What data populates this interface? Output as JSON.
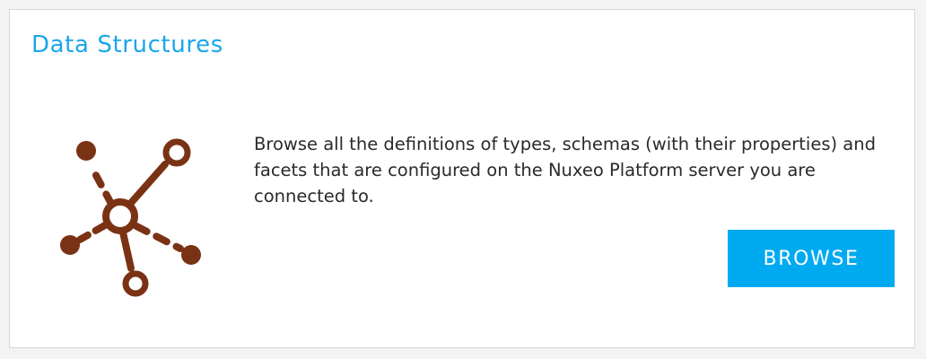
{
  "card": {
    "title": "Data Structures",
    "description": "Browse all the definitions of types, schemas (with their properties) and facets that are configured on the Nuxeo Platform server you are connected to.",
    "browse_label": "BROWSE",
    "icon": "network-graph-icon"
  },
  "colors": {
    "title": "#1ba6ea",
    "icon": "#7a3214",
    "button_background": "#00aaf0",
    "button_text": "#ffffff",
    "body_text": "#2a2a2a"
  }
}
